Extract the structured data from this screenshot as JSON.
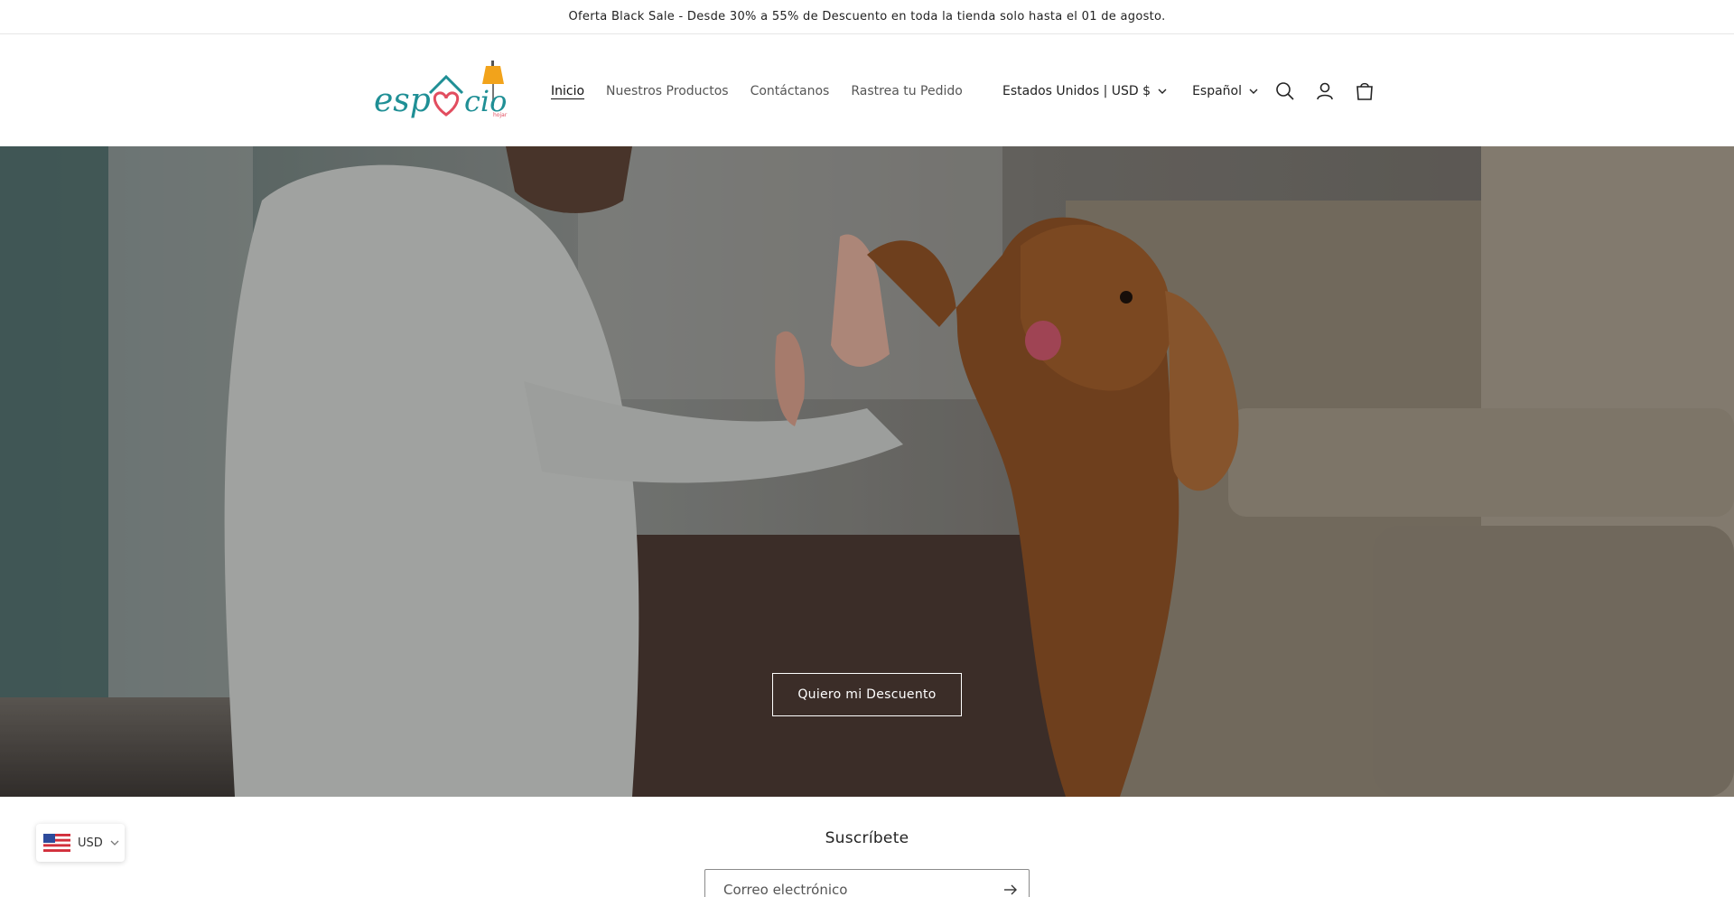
{
  "announcement": {
    "text": "Oferta Black Sale - Desde 30% a 55% de Descuento en toda la tienda solo hasta el 01 de agosto."
  },
  "header": {
    "logo": {
      "text_left": "esp",
      "text_right": "cio",
      "tagline": "hojar",
      "icon": "house-heart-lamp-logo"
    },
    "nav": [
      {
        "label": "Inicio",
        "active": true
      },
      {
        "label": "Nuestros Productos",
        "active": false
      },
      {
        "label": "Contáctanos",
        "active": false
      },
      {
        "label": "Rastrea tu Pedido",
        "active": false
      }
    ],
    "country_selector": "Estados Unidos | USD $",
    "language_selector": "Español",
    "icons": [
      "search-icon",
      "account-icon",
      "cart-icon"
    ]
  },
  "hero": {
    "button_label": "Quiero mi Descuento",
    "image": "woman-high-five-dog-photo"
  },
  "newsletter": {
    "title": "Suscríbete",
    "placeholder": "Correo electrónico"
  },
  "currency_widget": {
    "label": "USD",
    "icon": "us-flag-icon"
  },
  "colors": {
    "logo_teal": "#1f8f95",
    "logo_heart": "#e24d5f",
    "logo_lamp": "#f2a31b",
    "text": "#121212"
  }
}
